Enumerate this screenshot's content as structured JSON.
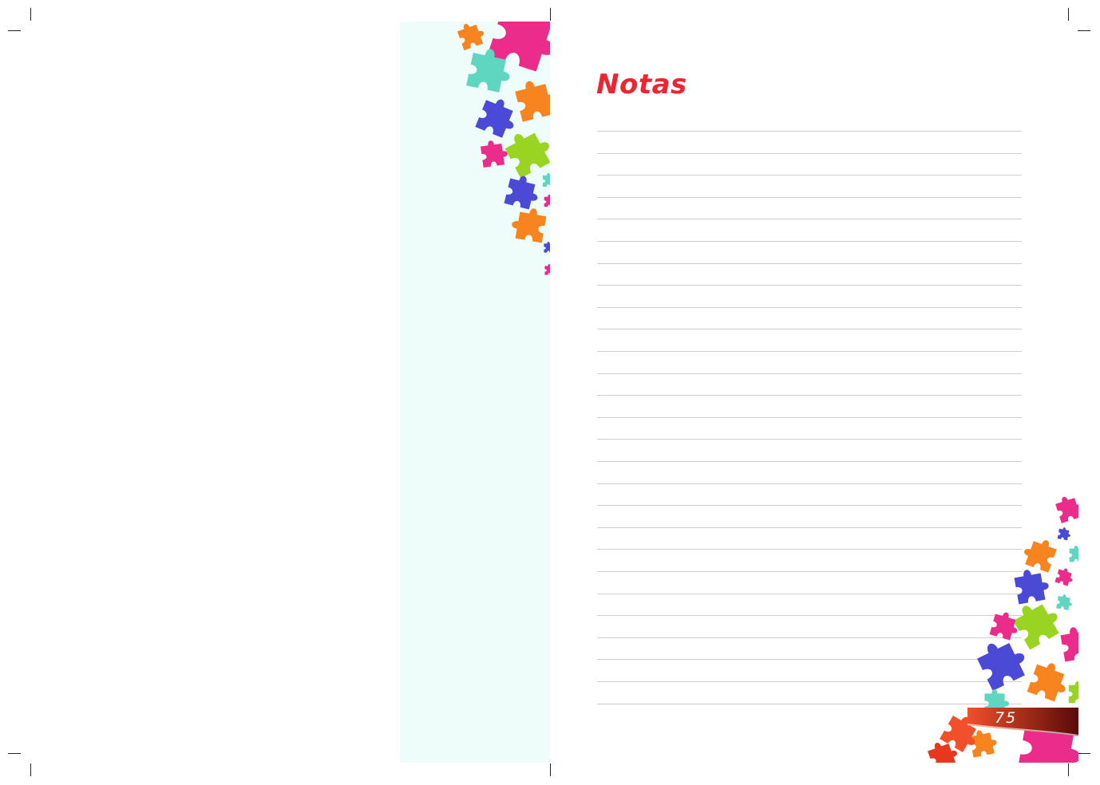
{
  "page": {
    "title": "Notas",
    "page_number": "75",
    "line_count": 27
  },
  "colors": {
    "title": "#ee2433",
    "strip_background": "#effdfa",
    "rule_line": "#cfcfcf",
    "banner_start": "#f0502a",
    "banner_end": "#5a0a0a",
    "puzzle_pink": "#ec2c8a",
    "puzzle_orange": "#f7841e",
    "puzzle_teal": "#5fd6c0",
    "puzzle_blue": "#4a4ad6",
    "puzzle_green": "#9ad423"
  },
  "icons": {
    "decoration": "puzzle-piece-icon"
  }
}
